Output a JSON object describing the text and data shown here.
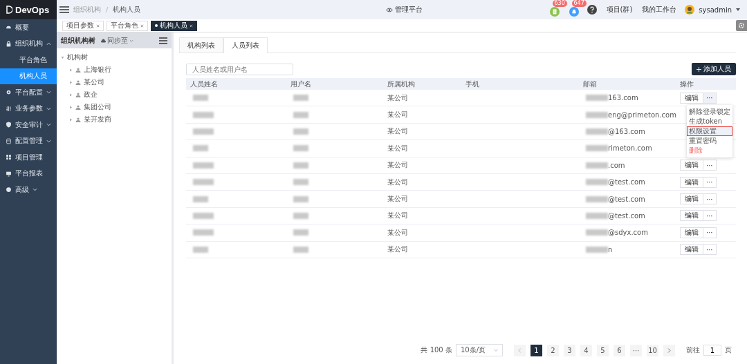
{
  "brand": "DevOps",
  "sidebar": {
    "items": [
      {
        "label": "概要",
        "selected": false
      },
      {
        "label": "组织机构",
        "expanded": true,
        "selected": false,
        "children": [
          {
            "label": "平台角色",
            "selected": false
          },
          {
            "label": "机构人员",
            "selected": true
          }
        ]
      },
      {
        "label": "平台配置",
        "expanded": false,
        "selected": false
      },
      {
        "label": "业务参数",
        "expanded": false,
        "selected": false
      },
      {
        "label": "安全审计",
        "expanded": false,
        "selected": false
      },
      {
        "label": "配置管理",
        "expanded": false,
        "selected": false
      },
      {
        "label": "项目管理",
        "selected": false
      },
      {
        "label": "平台报表",
        "selected": false
      },
      {
        "label": "高级",
        "expanded": false,
        "selected": false
      }
    ]
  },
  "topbar": {
    "breadcrumb": [
      "组织机构",
      "机构人员"
    ],
    "title": "管理平台",
    "badges": [
      {
        "kind": "document",
        "count": "630",
        "color": "#8bc34a"
      },
      {
        "kind": "bell",
        "count": "647",
        "color": "#409eff"
      }
    ],
    "links": [
      "项目(群)",
      "我的工作台"
    ],
    "user": "sysadmin"
  },
  "tags": [
    {
      "label": "项目参数",
      "selected": false
    },
    {
      "label": "平台角色",
      "selected": false
    },
    {
      "label": "机构人员",
      "selected": true
    }
  ],
  "tree": {
    "title": "组织机构树",
    "sync": "同步至",
    "root": {
      "label": "机构树",
      "expanded": true,
      "children": [
        {
          "label": "上海银行",
          "expanded": false
        },
        {
          "label": "某公司",
          "expanded": false
        },
        {
          "label": "政企",
          "expanded": false
        },
        {
          "label": "集团公司",
          "expanded": false
        },
        {
          "label": "某开发商",
          "expanded": false
        }
      ]
    }
  },
  "tabs": [
    {
      "label": "机构列表",
      "selected": false
    },
    {
      "label": "人员列表",
      "selected": true
    }
  ],
  "search": {
    "placeholder": "人员姓名或用户名"
  },
  "add_button": "添加人员",
  "table": {
    "columns": [
      "人员姓名",
      "用户名",
      "所属机构",
      "手机",
      "邮箱",
      "操作"
    ],
    "rows": [
      {
        "org": "某公司",
        "email": "163.com",
        "edit": "编辑",
        "more": "···"
      },
      {
        "org": "某公司",
        "email": "eng@primeton.com"
      },
      {
        "org": "某公司",
        "email": "@163.com"
      },
      {
        "org": "某公司",
        "email": "rimeton.com"
      },
      {
        "org": "某公司",
        "email": ".com",
        "edit": "编辑",
        "more": "···"
      },
      {
        "org": "某公司",
        "email": "@test.com",
        "edit": "编辑",
        "more": "···"
      },
      {
        "org": "某公司",
        "email": "@test.com",
        "edit": "编辑",
        "more": "···"
      },
      {
        "org": "某公司",
        "email": "@test.com",
        "edit": "编辑",
        "more": "···"
      },
      {
        "org": "某公司",
        "email": "@sdyx.com",
        "edit": "编辑",
        "more": "···"
      },
      {
        "org": "某公司",
        "email": "n",
        "edit": "编辑",
        "more": "···"
      }
    ]
  },
  "menu": {
    "items": [
      {
        "label": "解除登录锁定",
        "kind": "normal",
        "selected": false
      },
      {
        "label": "生成token",
        "kind": "normal",
        "selected": false
      },
      {
        "label": "权限设置",
        "kind": "normal",
        "selected": true
      },
      {
        "label": "重置密码",
        "kind": "normal",
        "selected": false
      },
      {
        "label": "删除",
        "kind": "danger",
        "selected": false
      }
    ]
  },
  "pagination": {
    "total": "共 100 条",
    "page_size": "10条/页",
    "pages": [
      {
        "label": "1",
        "selected": true
      },
      {
        "label": "2",
        "selected": false
      },
      {
        "label": "3",
        "selected": false
      },
      {
        "label": "4",
        "selected": false
      },
      {
        "label": "5",
        "selected": false
      },
      {
        "label": "6",
        "selected": false
      },
      {
        "label": "···",
        "selected": false
      },
      {
        "label": "10",
        "selected": false
      }
    ],
    "goto_label": "前往",
    "goto_value": "1",
    "goto_unit": "页"
  }
}
